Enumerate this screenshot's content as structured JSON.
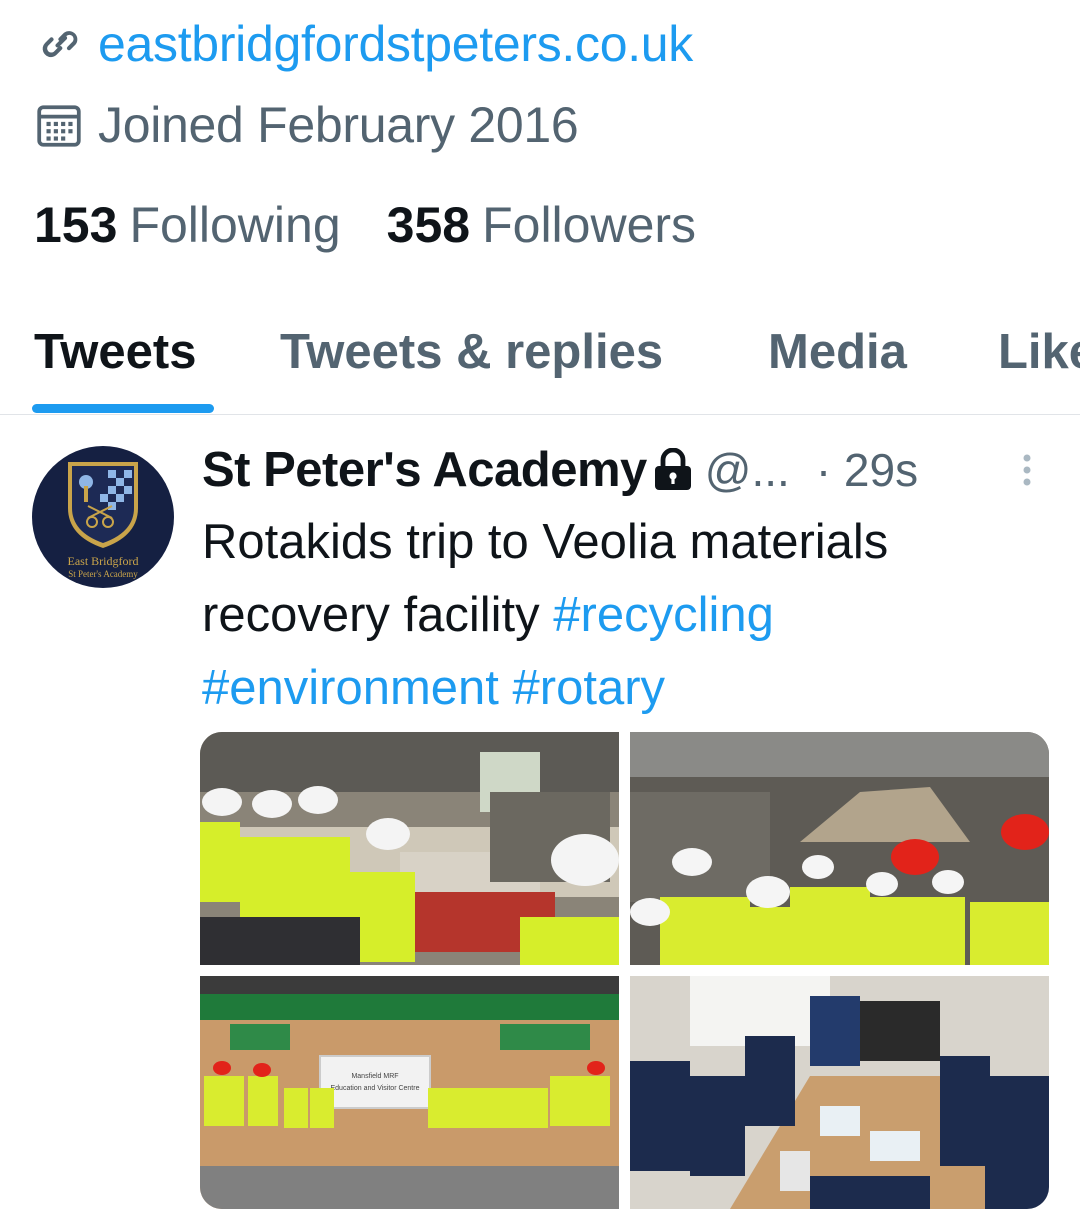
{
  "profile": {
    "website": "eastbridgfordstpeters.co.uk",
    "joined": "Joined February 2016",
    "following_count": "153",
    "following_label": "Following",
    "followers_count": "358",
    "followers_label": "Followers"
  },
  "tabs": [
    {
      "label": "Tweets",
      "active": true
    },
    {
      "label": "Tweets & replies",
      "active": false
    },
    {
      "label": "Media",
      "active": false
    },
    {
      "label": "Likes",
      "active": false
    }
  ],
  "tweet": {
    "author_name": "St Peter's Academy",
    "handle": "@...",
    "time": "· 29s",
    "text": "Rotakids trip to Veolia materials recovery facility",
    "hashtags": [
      "#recycling",
      "#environment",
      "#rotary"
    ],
    "avatar_text_line1": "East Bridgford",
    "avatar_text_line2": "St Peter's Academy",
    "photo_3_sign_line1": "Mansfield MRF",
    "photo_3_sign_line2": "Education and Visitor Centre"
  },
  "icons": {
    "website": "link-icon",
    "joined": "calendar-icon",
    "protected": "lock-icon",
    "more": "more-vertical-icon"
  },
  "colors": {
    "accent": "#1d9bf0",
    "text_primary": "#0f1419",
    "text_secondary": "#536471",
    "avatar_bg": "#152042"
  }
}
